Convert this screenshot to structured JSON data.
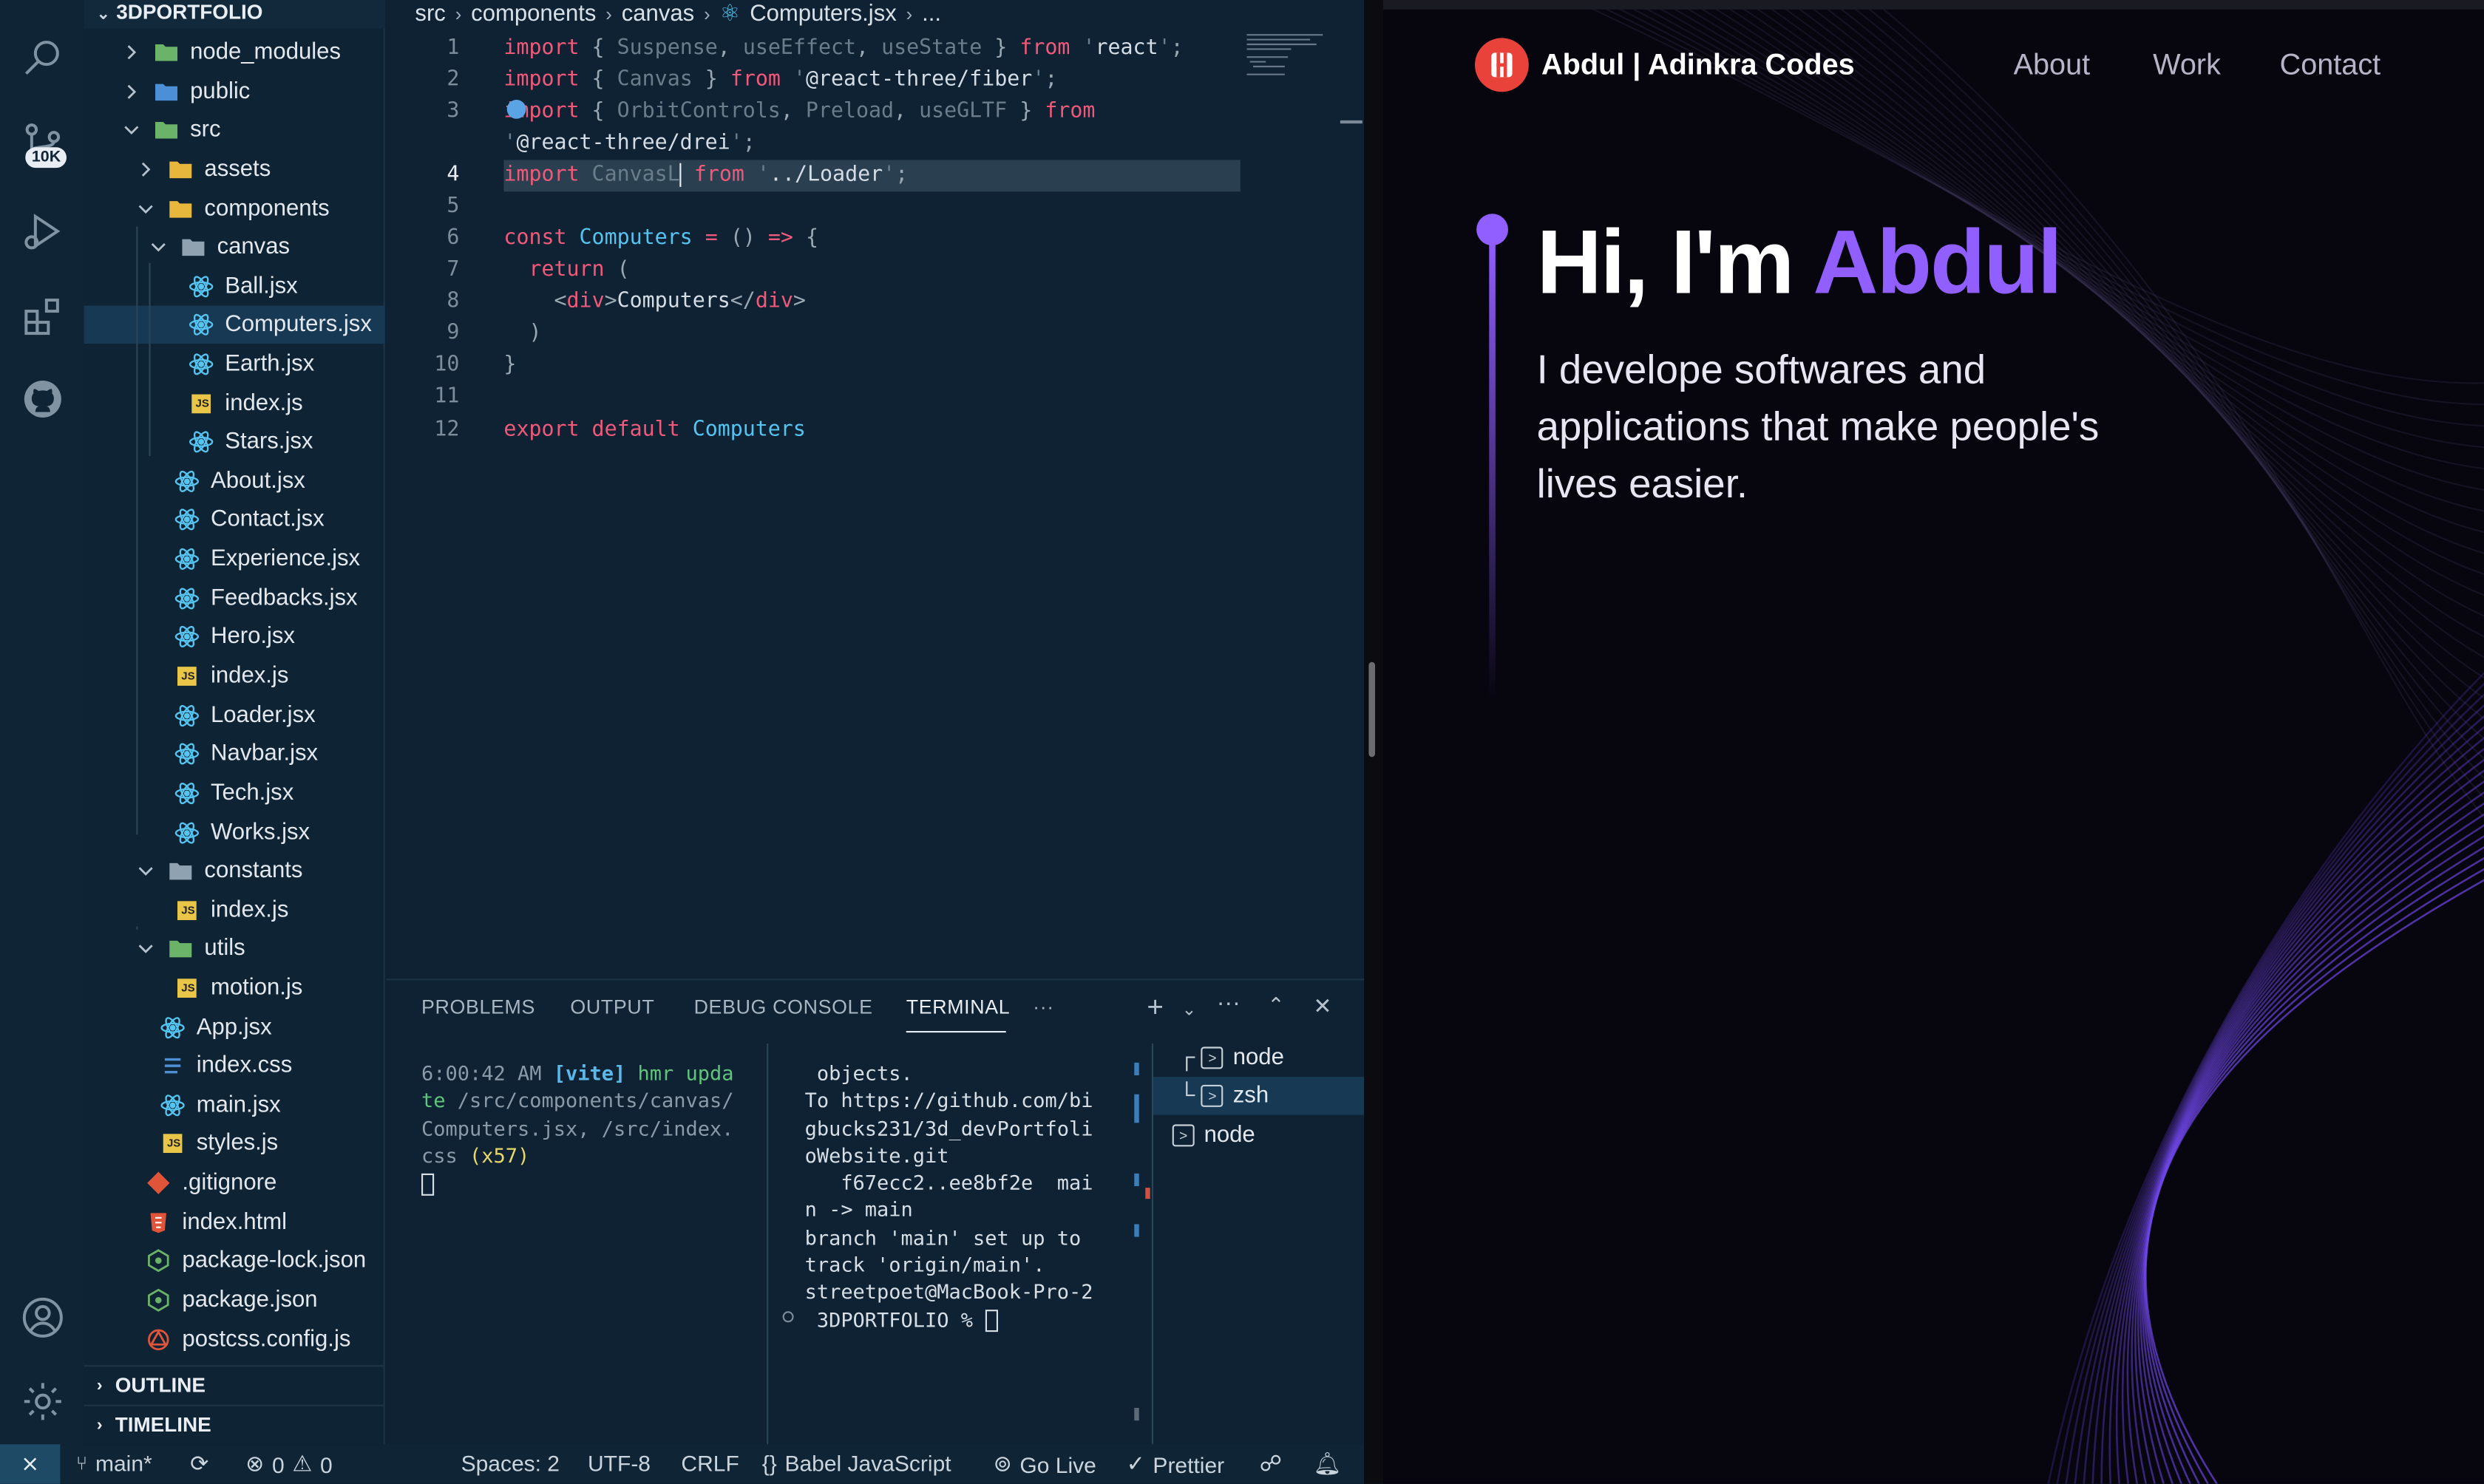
{
  "activity": {
    "badge": "10K"
  },
  "explorer": {
    "header": "3DPORTFOLIO",
    "items": [
      {
        "label": "node_modules"
      },
      {
        "label": "public"
      },
      {
        "label": "src"
      },
      {
        "label": "assets"
      },
      {
        "label": "components"
      },
      {
        "label": "canvas"
      },
      {
        "label": "Ball.jsx"
      },
      {
        "label": "Computers.jsx"
      },
      {
        "label": "Earth.jsx"
      },
      {
        "label": "index.js"
      },
      {
        "label": "Stars.jsx"
      },
      {
        "label": "About.jsx"
      },
      {
        "label": "Contact.jsx"
      },
      {
        "label": "Experience.jsx"
      },
      {
        "label": "Feedbacks.jsx"
      },
      {
        "label": "Hero.jsx"
      },
      {
        "label": "index.js"
      },
      {
        "label": "Loader.jsx"
      },
      {
        "label": "Navbar.jsx"
      },
      {
        "label": "Tech.jsx"
      },
      {
        "label": "Works.jsx"
      },
      {
        "label": "constants"
      },
      {
        "label": "index.js"
      },
      {
        "label": "utils"
      },
      {
        "label": "motion.js"
      },
      {
        "label": "App.jsx"
      },
      {
        "label": "index.css"
      },
      {
        "label": "main.jsx"
      },
      {
        "label": "styles.js"
      },
      {
        "label": ".gitignore"
      },
      {
        "label": "index.html"
      },
      {
        "label": "package-lock.json"
      },
      {
        "label": "package.json"
      },
      {
        "label": "postcss.config.js"
      }
    ],
    "outline": "OUTLINE",
    "timeline": "TIMELINE"
  },
  "breadcrumb": {
    "parts": [
      "src",
      "components",
      "canvas",
      "Computers.jsx",
      "..."
    ]
  },
  "editor": {
    "line_numbers": [
      "1",
      "2",
      "3",
      "",
      "4",
      "5",
      "6",
      "7",
      "8",
      "9",
      "10",
      "11",
      "12"
    ]
  },
  "panel": {
    "tabs": [
      "PROBLEMS",
      "OUTPUT",
      "DEBUG CONSOLE",
      "TERMINAL"
    ],
    "more": "···",
    "terminals": [
      "node",
      "zsh",
      "node"
    ]
  },
  "status": {
    "branch": "main*",
    "errors": "0",
    "warnings": "0",
    "spaces": "Spaces: 2",
    "encoding": "UTF-8",
    "eol": "CRLF",
    "language": "Babel JavaScript",
    "golive": "Go Live",
    "prettier": "Prettier"
  },
  "site": {
    "brand": "Abdul | Adinkra Codes",
    "nav": [
      "About",
      "Work",
      "Contact"
    ],
    "hero_prefix": "Hi, I'm ",
    "hero_name": "Abdul",
    "hero_sub": "I develope softwares and applications that make people's lives easier.",
    "accent": "#915eff"
  }
}
